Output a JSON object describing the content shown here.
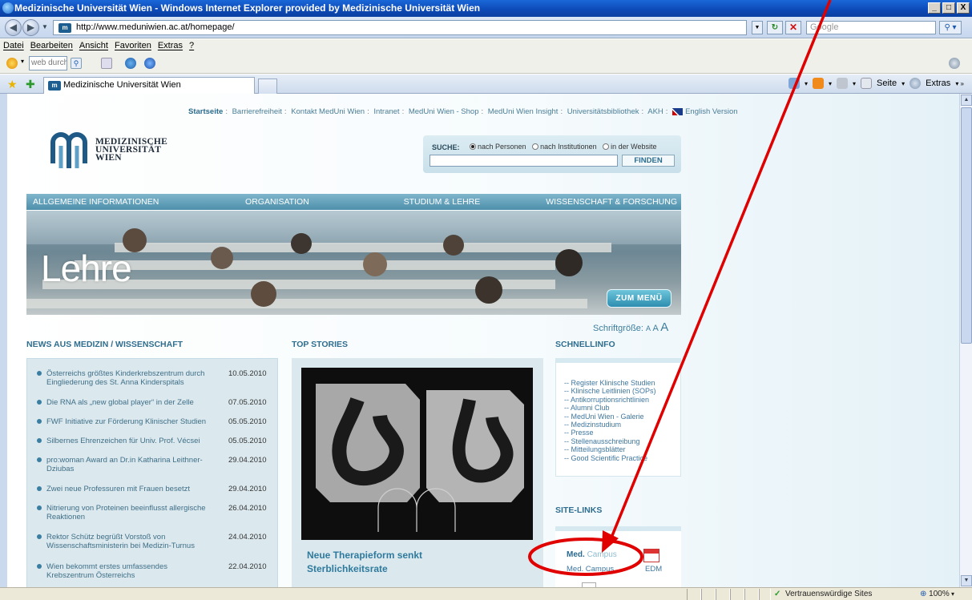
{
  "window": {
    "title": "Medizinische Universität Wien - Windows Internet Explorer provided by Medizinische Universität Wien",
    "controls": [
      "_",
      "□",
      "X"
    ]
  },
  "address": {
    "url": "http://www.meduniwien.ac.at/homepage/",
    "search_placeholder": "Google"
  },
  "menu": [
    "Datei",
    "Bearbeiten",
    "Ansicht",
    "Favoriten",
    "Extras",
    "?"
  ],
  "toolbar": {
    "search_value": "web durchsuc"
  },
  "tab": {
    "title": "Medizinische Universität Wien"
  },
  "command_bar": {
    "page_label": "Seite",
    "tools_label": "Extras"
  },
  "page": {
    "topnav": {
      "home": "Startseite",
      "links": [
        "Barrierefreiheit",
        "Kontakt MedUni Wien",
        "Intranet",
        "MedUni Wien - Shop",
        "MedUni Wien Insight",
        "Universitätsbibliothek",
        "AKH"
      ],
      "english": "English Version"
    },
    "logo": {
      "line1": "MEDIZINISCHE",
      "line2": "UNIVERSITÄT",
      "line3": "WIEN"
    },
    "search": {
      "label": "SUCHE:",
      "options": [
        "nach Personen",
        "nach Institutionen",
        "in der Website"
      ],
      "selected": "nach Personen",
      "button": "FINDEN"
    },
    "mainnav": [
      "ALLGEMEINE INFORMATIONEN",
      "ORGANISATION",
      "STUDIUM & LEHRE",
      "WISSENSCHAFT & FORSCHUNG"
    ],
    "hero": {
      "title": "Lehre",
      "button": "ZUM MENÜ"
    },
    "fontsize": {
      "label": "Schriftgröße:",
      "a": "A"
    },
    "news": {
      "heading": "NEWS AUS MEDIZIN / WISSENSCHAFT",
      "items": [
        {
          "title": "Österreichs größtes Kinderkrebszentrum durch Eingliederung des St. Anna Kinderspitals",
          "date": "10.05.2010"
        },
        {
          "title": "Die RNA als „new global player“ in der Zelle",
          "date": "07.05.2010"
        },
        {
          "title": "FWF Initiative zur Förderung Klinischer Studien",
          "date": "05.05.2010"
        },
        {
          "title": "Silbernes Ehrenzeichen für Univ. Prof. Vécsei",
          "date": "05.05.2010"
        },
        {
          "title": "pro:woman Award an Dr.in Katharina Leithner-Dziubas",
          "date": "29.04.2010"
        },
        {
          "title": "Zwei neue Professuren mit Frauen besetzt",
          "date": "29.04.2010"
        },
        {
          "title": "Nitrierung von Proteinen beeinflusst allergische Reaktionen",
          "date": "26.04.2010"
        },
        {
          "title": "Rektor Schütz begrüßt Vorstoß von Wissenschaftsministerin bei Medizin-Turnus",
          "date": "24.04.2010"
        },
        {
          "title": "Wien bekommt erstes umfassendes Krebszentrum Österreichs",
          "date": "22.04.2010"
        }
      ]
    },
    "top_stories": {
      "heading": "TOP STORIES",
      "caption_line1": "Neue Therapieform senkt",
      "caption_line2": "Sterblichkeitsrate"
    },
    "schnellinfo": {
      "heading": "SCHNELLINFO",
      "items": [
        "-- Register Klinische Studien",
        "-- Klinische Leitlinien (SOPs)",
        "-- Antikorruptionsrichtlinien",
        "-- Alumni Club",
        "-- MedUni Wien - Galerie",
        "-- Medizinstudium",
        "-- Presse",
        "-- Stellenausschreibung",
        "-- Mitteilungsblätter",
        "-- Good Scientific Practice"
      ]
    },
    "site_links": {
      "heading": "SITE-LINKS",
      "medcampus_logo_a": "Med.",
      "medcampus_logo_b": "Campus",
      "medcampus_label": "Med. Campus",
      "edm_label": "EDM"
    }
  },
  "status": {
    "trusted": "Vertrauenswürdige Sites",
    "zoom": "100%"
  },
  "colors": {
    "accent": "#2f6e8f",
    "nav_bar": "#4e8fab",
    "annotation_red": "#e00000"
  }
}
